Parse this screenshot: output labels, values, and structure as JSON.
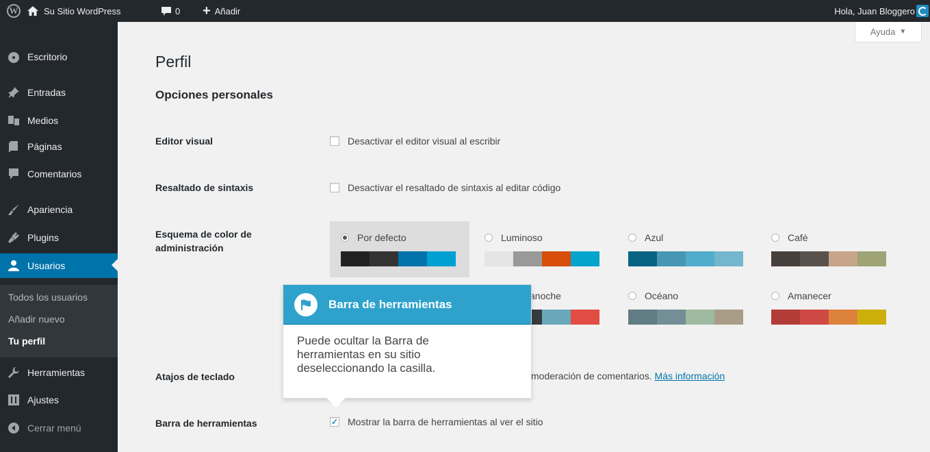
{
  "admin_bar": {
    "site_name": "Su Sitio WordPress",
    "comments_count": "0",
    "new_label": "Añadir",
    "howdy": "Hola, Juan Bloggero"
  },
  "sidebar": {
    "items": [
      {
        "label": "Escritorio",
        "icon": "dashboard-icon"
      },
      {
        "label": "Entradas",
        "icon": "pin-icon"
      },
      {
        "label": "Medios",
        "icon": "media-icon"
      },
      {
        "label": "Páginas",
        "icon": "pages-icon"
      },
      {
        "label": "Comentarios",
        "icon": "comment-icon"
      },
      {
        "label": "Apariencia",
        "icon": "brush-icon"
      },
      {
        "label": "Plugins",
        "icon": "plug-icon"
      },
      {
        "label": "Usuarios",
        "icon": "users-icon"
      },
      {
        "label": "Herramientas",
        "icon": "wrench-icon"
      },
      {
        "label": "Ajustes",
        "icon": "settings-icon"
      },
      {
        "label": "Cerrar menú",
        "icon": "collapse-icon"
      }
    ],
    "submenu": [
      "Todos los usuarios",
      "Añadir nuevo",
      "Tu perfil"
    ]
  },
  "help_tab": "Ayuda",
  "page": {
    "title": "Perfil",
    "section": "Opciones personales"
  },
  "fields": {
    "visual_editor": {
      "label": "Editor visual",
      "option": "Desactivar el editor visual al escribir",
      "checked": false
    },
    "syntax": {
      "label": "Resaltado de sintaxis",
      "option": "Desactivar el resaltado de sintaxis al editar código",
      "checked": false
    },
    "color_scheme": {
      "label_line1": "Esquema de color de",
      "label_line2": "administración"
    },
    "shortcuts": {
      "label": "Atajos de teclado",
      "option_tail": "moderación de comentarios.",
      "link": "Más información"
    },
    "toolbar": {
      "label": "Barra de herramientas",
      "option": "Mostrar la barra de herramientas al ver el sitio",
      "checked": true
    }
  },
  "color_schemes": [
    {
      "name": "Por defecto",
      "selected": true,
      "colors": [
        "#222222",
        "#333333",
        "#0073aa",
        "#00a0d2"
      ]
    },
    {
      "name": "Luminoso",
      "selected": false,
      "colors": [
        "#e5e5e5",
        "#999999",
        "#d64e07",
        "#04a4cc"
      ]
    },
    {
      "name": "Azul",
      "selected": false,
      "colors": [
        "#096484",
        "#4796b3",
        "#52accc",
        "#74b6ce"
      ]
    },
    {
      "name": "Café",
      "selected": false,
      "colors": [
        "#46403c",
        "#59524c",
        "#c7a589",
        "#9ea476"
      ]
    },
    {
      "name": "anoche",
      "selected": false,
      "colors": [
        "#363b3f",
        "#69a8bb",
        "#e14d43"
      ]
    },
    {
      "name": "Océano",
      "selected": false,
      "colors": [
        "#627c83",
        "#738e96",
        "#9ebaa0",
        "#aa9d88"
      ]
    },
    {
      "name": "Amanecer",
      "selected": false,
      "colors": [
        "#b43c38",
        "#cf4944",
        "#dd823b",
        "#ccaf0b"
      ]
    }
  ],
  "tooltip": {
    "title": "Barra de herramientas",
    "body_line1": "Puede ocultar la Barra de",
    "body_line2": "herramientas en su sitio",
    "body_line3": "deseleccionando la casilla."
  }
}
